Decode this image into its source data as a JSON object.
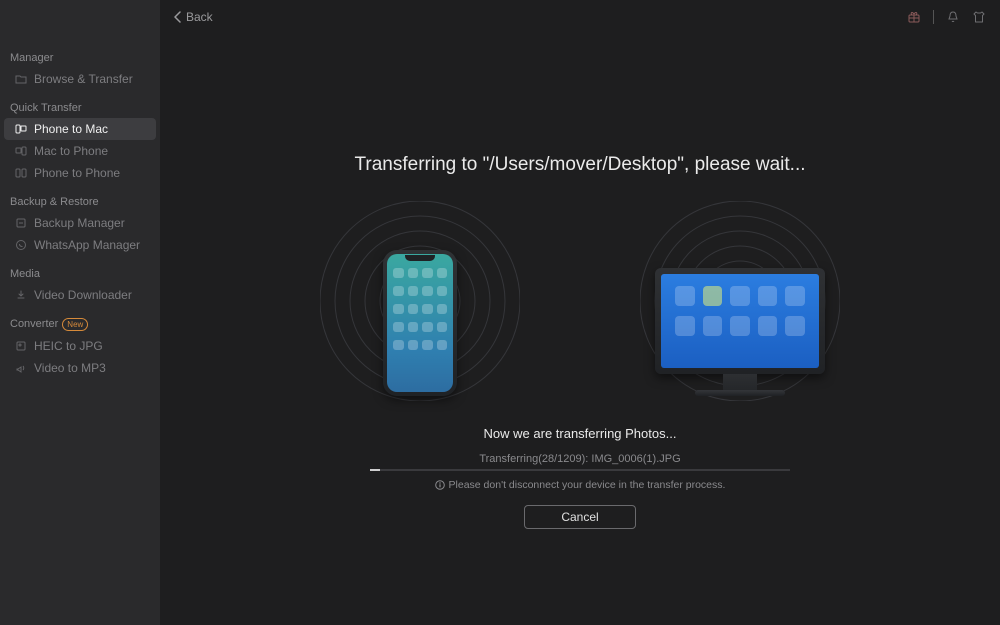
{
  "header": {
    "back_label": "Back"
  },
  "sidebar": {
    "groups": [
      {
        "label": "Manager",
        "items": [
          {
            "label": "Browse & Transfer",
            "icon": "folder-icon",
            "active": false
          }
        ]
      },
      {
        "label": "Quick Transfer",
        "items": [
          {
            "label": "Phone to Mac",
            "icon": "phone-to-mac-icon",
            "active": true
          },
          {
            "label": "Mac to Phone",
            "icon": "mac-to-phone-icon",
            "active": false
          },
          {
            "label": "Phone to Phone",
            "icon": "phone-to-phone-icon",
            "active": false
          }
        ]
      },
      {
        "label": "Backup & Restore",
        "items": [
          {
            "label": "Backup Manager",
            "icon": "backup-icon",
            "active": false
          },
          {
            "label": "WhatsApp Manager",
            "icon": "whatsapp-icon",
            "active": false
          }
        ]
      },
      {
        "label": "Media",
        "items": [
          {
            "label": "Video Downloader",
            "icon": "download-icon",
            "active": false
          }
        ]
      },
      {
        "label": "Converter",
        "badge": "New",
        "items": [
          {
            "label": "HEIC to JPG",
            "icon": "image-convert-icon",
            "active": false
          },
          {
            "label": "Video to MP3",
            "icon": "audio-convert-icon",
            "active": false
          }
        ]
      }
    ]
  },
  "transfer": {
    "title": "Transferring to \"/Users/mover/Desktop\", please wait...",
    "status_line": "Now we are transferring Photos...",
    "detail_line": "Transferring(28/1209): IMG_0006(1).JPG",
    "warning": "Please don't disconnect your device in the transfer process.",
    "cancel_label": "Cancel",
    "progress_pct": 2.3
  }
}
